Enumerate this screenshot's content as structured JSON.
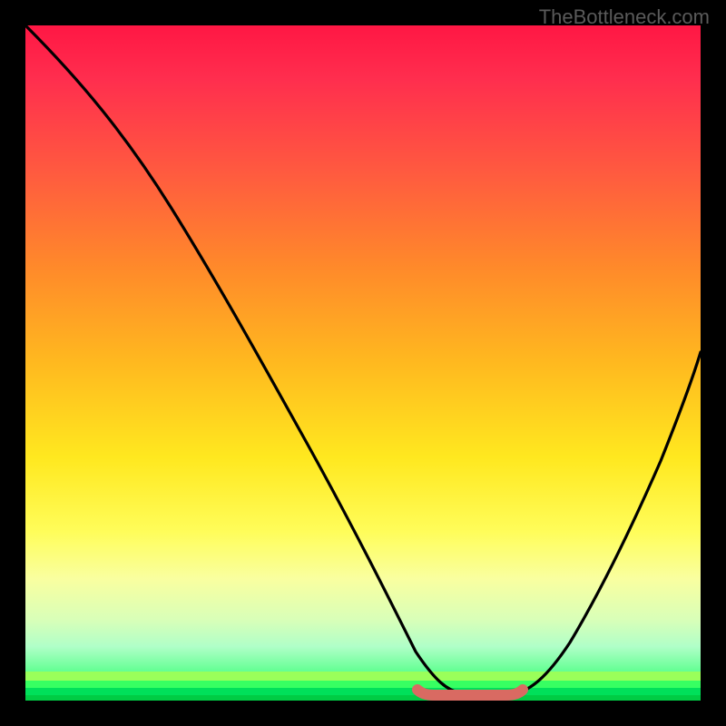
{
  "watermark": "TheBottleneck.com",
  "chart_data": {
    "type": "line",
    "title": "",
    "xlabel": "",
    "ylabel": "",
    "x_range": [
      0,
      100
    ],
    "y_range": [
      0,
      100
    ],
    "series": [
      {
        "name": "bottleneck-curve",
        "x": [
          0,
          5,
          10,
          15,
          20,
          25,
          30,
          35,
          40,
          45,
          50,
          55,
          58,
          60,
          63,
          66,
          69,
          72,
          75,
          80,
          85,
          90,
          95,
          100
        ],
        "y": [
          100,
          95,
          89,
          82,
          75,
          67,
          59,
          51,
          43,
          34,
          25,
          15,
          8,
          3,
          1,
          0,
          0,
          1,
          3,
          8,
          17,
          28,
          40,
          52
        ]
      },
      {
        "name": "optimal-flat-zone",
        "x": [
          58,
          72
        ],
        "y": [
          0.6,
          0.6
        ]
      }
    ],
    "gradient_stops": [
      {
        "pos": 0,
        "color": "#ff1744"
      },
      {
        "pos": 50,
        "color": "#ffe81f"
      },
      {
        "pos": 100,
        "color": "#00e05a"
      }
    ],
    "annotations": []
  }
}
